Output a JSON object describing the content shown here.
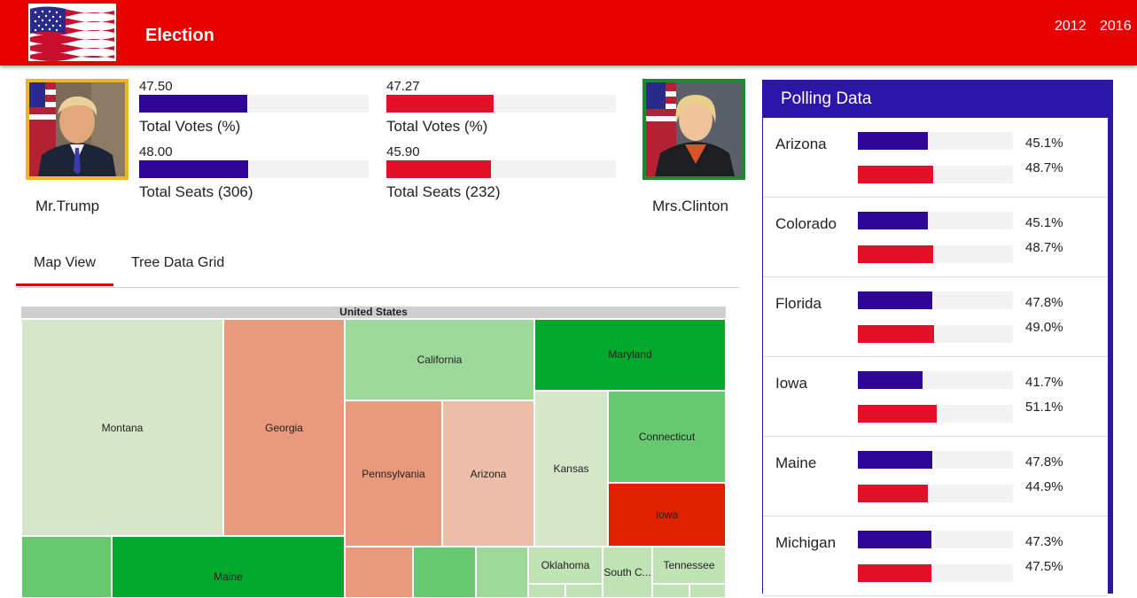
{
  "header": {
    "title": "Election",
    "years": [
      "2012",
      "2016"
    ]
  },
  "candidates": {
    "trump": {
      "name": "Mr.Trump",
      "votes_value": "47.50",
      "votes_label": "Total Votes (%)",
      "seats_value": "48.00",
      "seats_label": "Total Seats (306)",
      "votes_fraction": 0.475,
      "seats_fraction": 0.48
    },
    "clinton": {
      "name": "Mrs.Clinton",
      "votes_value": "47.27",
      "votes_label": "Total Votes (%)",
      "seats_value": "45.90",
      "seats_label": "Total Seats (232)",
      "votes_fraction": 0.4727,
      "seats_fraction": 0.459
    }
  },
  "tabs": [
    "Map View",
    "Tree Data Grid"
  ],
  "treemap": {
    "root": "United States",
    "labels": {
      "montana": "Montana",
      "georgia": "Georgia",
      "california": "California",
      "maryland": "Maryland",
      "pennsylvania": "Pennsylvania",
      "arizona": "Arizona",
      "kansas": "Kansas",
      "connecticut": "Connecticut",
      "iowa": "Iowa",
      "maine": "Maine",
      "oklahoma": "Oklahoma",
      "south_carolina": "South C...",
      "tennessee": "Tennessee"
    }
  },
  "polling": {
    "title": "Polling Data",
    "rows": [
      {
        "state": "Arizona",
        "rep": "45.1%",
        "dem": "48.7%"
      },
      {
        "state": "Colorado",
        "rep": "45.1%",
        "dem": "48.7%"
      },
      {
        "state": "Florida",
        "rep": "47.8%",
        "dem": "49.0%"
      },
      {
        "state": "Iowa",
        "rep": "41.7%",
        "dem": "51.1%"
      },
      {
        "state": "Maine",
        "rep": "47.8%",
        "dem": "44.9%"
      },
      {
        "state": "Michigan",
        "rep": "47.3%",
        "dem": "47.5%"
      }
    ]
  },
  "colors": {
    "header_red": "#e60000",
    "republican": "#2e0696",
    "democrat": "#e4102a",
    "poll_panel": "#2b16a8",
    "photo_border_trump": "#f0b429",
    "photo_border_clinton": "#1e8a2e"
  }
}
